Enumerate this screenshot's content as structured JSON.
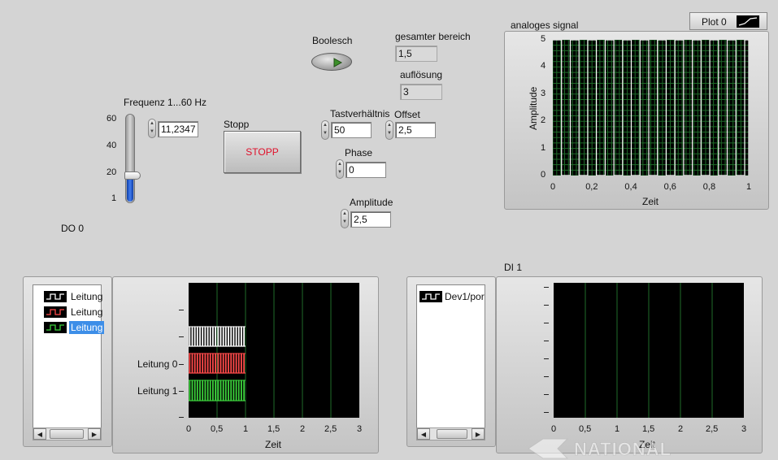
{
  "controls": {
    "boolean_label": "Boolesch",
    "range_label": "gesamter bereich",
    "range_value": "1,5",
    "resolution_label": "auflösung",
    "resolution_value": "3",
    "freq_label": "Frequenz 1...60 Hz",
    "freq_value": "11,2347",
    "freq_ticks": [
      "60",
      "40",
      "20",
      "1"
    ],
    "freq_level": 11.2347,
    "stop_label": "Stopp",
    "stop_button": "STOPP",
    "duty_label": "Tastverhältnis",
    "duty_value": "50",
    "offset_label": "Offset",
    "offset_value": "2,5",
    "phase_label": "Phase",
    "phase_value": "0",
    "amplitude_label": "Amplitude",
    "amplitude_value": "2,5",
    "do_label": "DO 0",
    "di_label": "DI 1"
  },
  "analog_graph": {
    "title": "analoges signal",
    "plot_legend": "Plot 0",
    "ylabel": "Amplitude",
    "xlabel": "Zeit",
    "yticks": [
      "5",
      "4",
      "3",
      "2",
      "1",
      "0"
    ],
    "xticks": [
      "0",
      "0,2",
      "0,4",
      "0,6",
      "0,8",
      "1"
    ]
  },
  "do_graph": {
    "legend": [
      "Leitung",
      "Leitung",
      "Leitung"
    ],
    "row_labels": [
      "Leitung 0",
      "Leitung 1"
    ],
    "xlabel": "Zeit",
    "xticks": [
      "0",
      "0,5",
      "1",
      "1,5",
      "2",
      "2,5",
      "3"
    ]
  },
  "di_graph": {
    "legend": [
      "Dev1/por"
    ],
    "xlabel": "Zeit",
    "xticks": [
      "0",
      "0,5",
      "1",
      "1,5",
      "2",
      "2,5",
      "3"
    ]
  },
  "watermark": "NATIONAL",
  "chart_data": [
    {
      "type": "line",
      "title": "analoges signal",
      "xlabel": "Zeit",
      "ylabel": "Amplitude",
      "xlim": [
        0,
        1
      ],
      "ylim": [
        0,
        5
      ],
      "grid": true,
      "series": [
        {
          "name": "Plot 0",
          "shape": "square wave",
          "low": 0,
          "high": 5,
          "frequency_hz": 11.2347,
          "duty_cycle_percent": 50
        }
      ]
    },
    {
      "type": "line",
      "xlabel": "Zeit",
      "xlim": [
        0,
        3
      ],
      "grid": true,
      "series": [
        {
          "name": "Leitung",
          "color": "#ffffff",
          "x_range": [
            0,
            1
          ]
        },
        {
          "name": "Leitung 0",
          "color": "#ff4a4a",
          "x_range": [
            0,
            1
          ]
        },
        {
          "name": "Leitung 1",
          "color": "#3cd23c",
          "x_range": [
            0,
            1
          ]
        }
      ]
    },
    {
      "type": "line",
      "xlabel": "Zeit",
      "xlim": [
        0,
        3
      ],
      "grid": true,
      "series": []
    }
  ],
  "colors": {
    "panel_bg": "#d4d4d4",
    "plot_bg": "#000000",
    "grid": "#1f6b2a",
    "analog_trace": "#ffffff",
    "led_green": "#3c8f2a",
    "slider_fill": "#1e5bd8",
    "legend_selected": "#3d8ee8",
    "stop_text": "#e0102a"
  }
}
